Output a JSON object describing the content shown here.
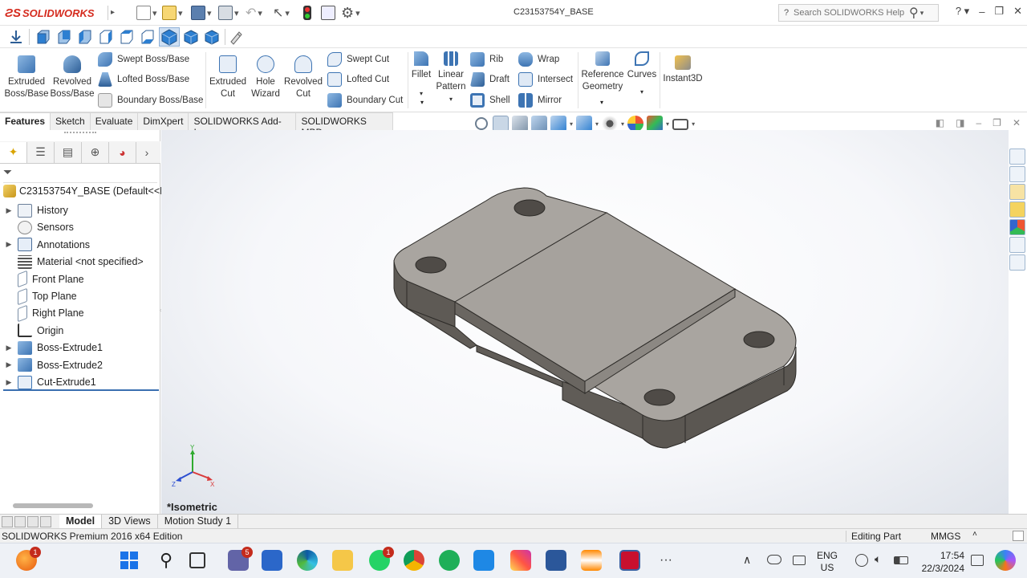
{
  "app": {
    "brand": "SOLIDWORKS",
    "document_title": "C23153754Y_BASE",
    "search_placeholder": "Search SOLIDWORKS Help",
    "help_label": "?"
  },
  "ribbon": {
    "extruded_boss": "Extruded Boss/Base",
    "revolved_boss": "Revolved Boss/Base",
    "swept_boss": "Swept Boss/Base",
    "lofted_boss": "Lofted Boss/Base",
    "boundary_boss": "Boundary Boss/Base",
    "extruded_cut": "Extruded Cut",
    "hole_wizard": "Hole Wizard",
    "revolved_cut": "Revolved Cut",
    "swept_cut": "Swept Cut",
    "lofted_cut": "Lofted Cut",
    "boundary_cut": "Boundary Cut",
    "fillet": "Fillet",
    "linear_pattern": "Linear Pattern",
    "rib": "Rib",
    "draft": "Draft",
    "shell": "Shell",
    "wrap": "Wrap",
    "intersect": "Intersect",
    "mirror": "Mirror",
    "reference_geometry": "Reference Geometry",
    "curves": "Curves",
    "instant3d": "Instant3D"
  },
  "tabs": [
    "Features",
    "Sketch",
    "Evaluate",
    "DimXpert",
    "SOLIDWORKS Add-Ins",
    "SOLIDWORKS MBD"
  ],
  "tree": {
    "root": "C23153754Y_BASE  (Default<<D",
    "items": [
      {
        "label": "History",
        "expandable": true,
        "icon": "history-icon"
      },
      {
        "label": "Sensors",
        "expandable": false,
        "icon": "sensors-icon"
      },
      {
        "label": "Annotations",
        "expandable": true,
        "icon": "annotations-icon"
      },
      {
        "label": "Material <not specified>",
        "expandable": false,
        "icon": "material-icon"
      },
      {
        "label": "Front Plane",
        "expandable": false,
        "icon": "plane-icon"
      },
      {
        "label": "Top Plane",
        "expandable": false,
        "icon": "plane-icon"
      },
      {
        "label": "Right Plane",
        "expandable": false,
        "icon": "plane-icon"
      },
      {
        "label": "Origin",
        "expandable": false,
        "icon": "origin-icon"
      },
      {
        "label": "Boss-Extrude1",
        "expandable": true,
        "icon": "boss-extrude-icon"
      },
      {
        "label": "Boss-Extrude2",
        "expandable": true,
        "icon": "boss-extrude-icon"
      },
      {
        "label": "Cut-Extrude1",
        "expandable": true,
        "icon": "cut-extrude-icon"
      }
    ]
  },
  "viewport": {
    "view_name": "*Isometric",
    "triad": {
      "x": "X",
      "y": "Y",
      "z": "Z"
    }
  },
  "bottom_tabs": [
    "Model",
    "3D Views",
    "Motion Study 1"
  ],
  "status": {
    "edition": "SOLIDWORKS Premium 2016 x64 Edition",
    "mode": "Editing Part",
    "units": "MMGS",
    "caret": "˄"
  },
  "taskbar": {
    "teams_badge": "5",
    "whatsapp_badge": "1",
    "firefox_badge": "1",
    "lang_top": "ENG",
    "lang_bottom": "US",
    "time": "17:54",
    "date": "22/3/2024",
    "more": "···",
    "chevron": "∧"
  },
  "colors": {
    "accent": "#3a6fb0",
    "brand_red": "#d52b1e",
    "part_top": "#a7a39e",
    "part_side": "#5e5a55"
  }
}
